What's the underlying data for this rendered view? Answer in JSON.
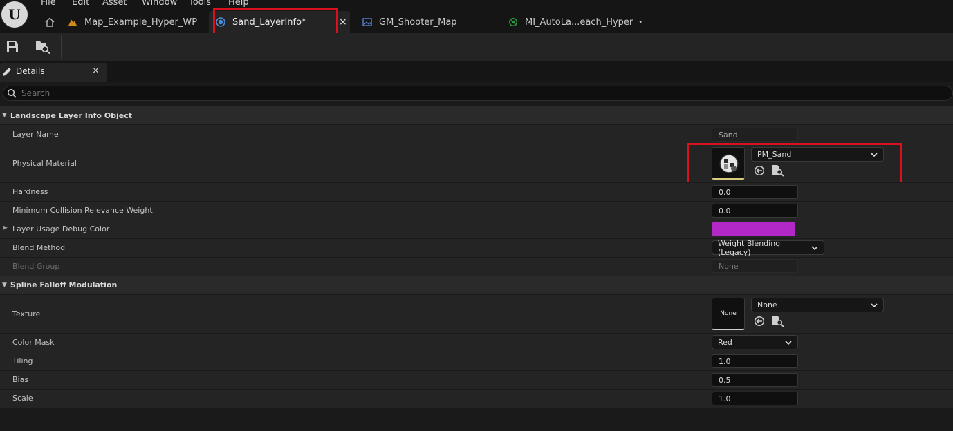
{
  "menu": [
    "File",
    "Edit",
    "Asset",
    "Window",
    "Tools",
    "Help"
  ],
  "tabs": [
    {
      "label": "Map_Example_Hyper_WP"
    },
    {
      "label": "Sand_LayerInfo*"
    },
    {
      "label": "GM_Shooter_Map"
    },
    {
      "label": "MI_AutoLa...each_Hyper"
    }
  ],
  "tab_close_glyph": "×",
  "tab_dirty_dot": "•",
  "details": {
    "title": "Details",
    "close_glyph": "×",
    "search_placeholder": "Search"
  },
  "sections": {
    "landscape": "Landscape Layer Info Object",
    "spline": "Spline Falloff Modulation"
  },
  "props": {
    "layer_name": {
      "label": "Layer Name",
      "value": "Sand"
    },
    "physical_material": {
      "label": "Physical Material",
      "value": "PM_Sand"
    },
    "hardness": {
      "label": "Hardness",
      "value": "0.0"
    },
    "min_collision": {
      "label": "Minimum Collision Relevance Weight",
      "value": "0.0"
    },
    "debug_color": {
      "label": "Layer Usage Debug Color",
      "color": "#b128c7"
    },
    "blend_method": {
      "label": "Blend Method",
      "value": "Weight Blending (Legacy)"
    },
    "blend_group": {
      "label": "Blend Group",
      "value": "None"
    },
    "texture": {
      "label": "Texture",
      "value": "None",
      "thumb_text": "None"
    },
    "color_mask": {
      "label": "Color Mask",
      "value": "Red"
    },
    "tiling": {
      "label": "Tiling",
      "value": "1.0"
    },
    "bias": {
      "label": "Bias",
      "value": "0.5"
    },
    "scale": {
      "label": "Scale",
      "value": "1.0"
    }
  },
  "colors": {
    "highlight": "#d8121c",
    "debug_color": "#b128c7"
  }
}
